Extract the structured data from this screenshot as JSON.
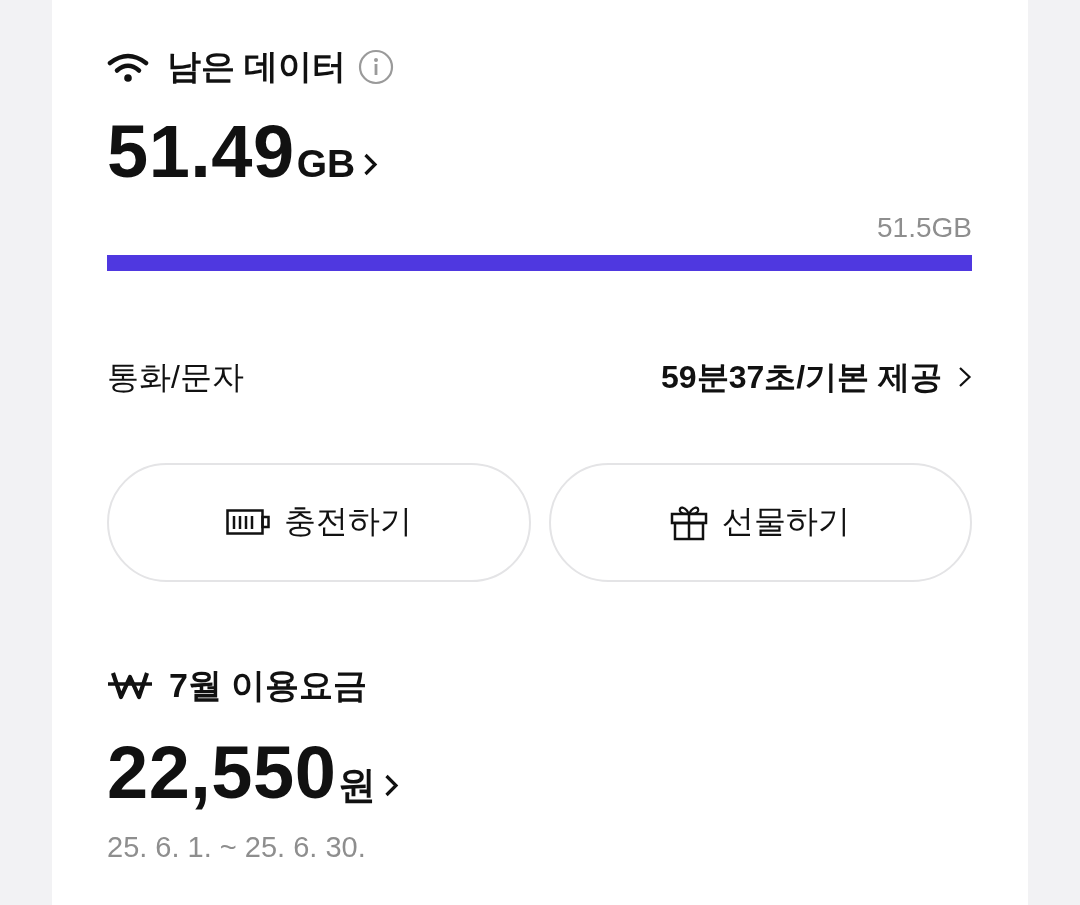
{
  "data_card": {
    "title": "남은 데이터",
    "remaining": {
      "value": "51.49",
      "unit": "GB"
    },
    "total": "51.5GB",
    "usage_bar": {
      "level": 1
    },
    "calls": {
      "label": "통화/문자",
      "value": "59분37초/기본 제공"
    },
    "buttons": [
      {
        "kind": "charge",
        "label": "충전하기"
      },
      {
        "kind": "gift",
        "label": "선물하기"
      }
    ]
  },
  "bill": {
    "title": "7월 이용요금",
    "amount": {
      "value": "22,550",
      "unit": "원"
    },
    "period": "25. 6. 1. ~ 25. 6. 30."
  }
}
